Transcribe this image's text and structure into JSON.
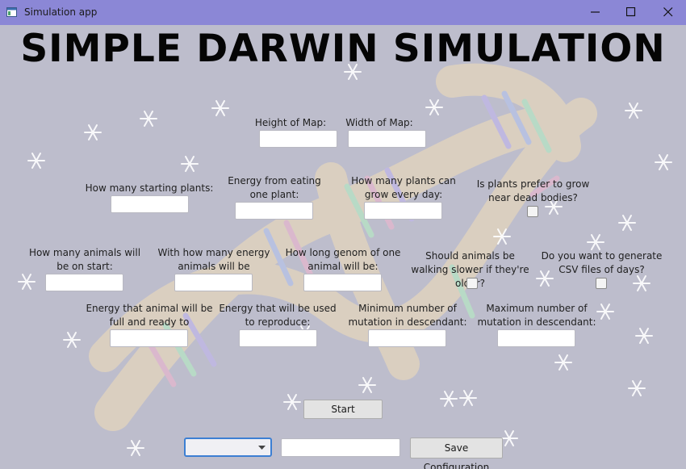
{
  "window": {
    "title": "Simulation app"
  },
  "heading": "SIMPLE DARWIN SIMULATION",
  "fields": {
    "map_height": "Height of Map:",
    "map_width": "Width of Map:",
    "starting_plants": "How many starting plants:",
    "energy_from_plant": "Energy from eating one plant:",
    "plants_per_day": "How many plants can grow every day:",
    "plants_near_dead": "Is plants prefer to grow near dead bodies?",
    "starting_animals": "How many animals will be on start:",
    "starting_energy": "With how many energy animals will be starting:",
    "genome_length": "How long genom of one animal will be:",
    "slower_when_older": "Should animals be walking slower if they're older?",
    "generate_csv": "Do you want to generate CSV files of days?",
    "energy_full": "Energy that animal will be full and ready to reproduce:",
    "energy_reproduce": "Energy that will be used to reproduce:",
    "min_mutation": "Minimum number of mutation in descendant:",
    "max_mutation": "Maximum number of mutation in descendant:"
  },
  "buttons": {
    "start": "Start",
    "save_config": "Save Configuration"
  },
  "config": {
    "selected": "",
    "name_value": ""
  },
  "icons": {
    "app": "app-window-icon",
    "minimize": "minimize-icon",
    "maximize": "maximize-icon",
    "close": "close-icon",
    "dropdown": "chevron-down-icon",
    "background": "dna-helix-background",
    "decoration": "snowflake-icon"
  },
  "colors": {
    "titlebar": "#8b87d6",
    "background": "#bdbdcc",
    "combo_focus": "#3c7fd3"
  }
}
